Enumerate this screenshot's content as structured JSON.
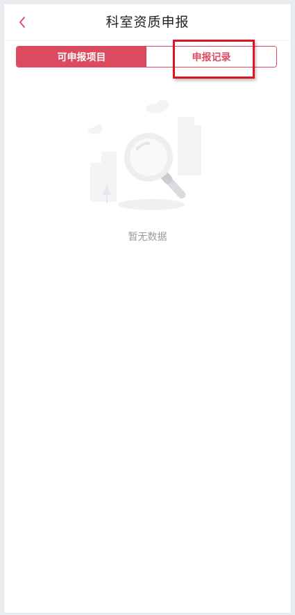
{
  "header": {
    "title": "科室资质申报",
    "back_icon": "chevron-left-icon"
  },
  "tabs": [
    {
      "label": "可申报项目",
      "active": true
    },
    {
      "label": "申报记录",
      "active": false
    }
  ],
  "empty_state": {
    "icon": "magnifier-empty-illustration",
    "message": "暂无数据"
  },
  "colors": {
    "accent": "#dc4a5f",
    "highlight": "#e0141e",
    "empty_text": "#9a9a9a"
  }
}
